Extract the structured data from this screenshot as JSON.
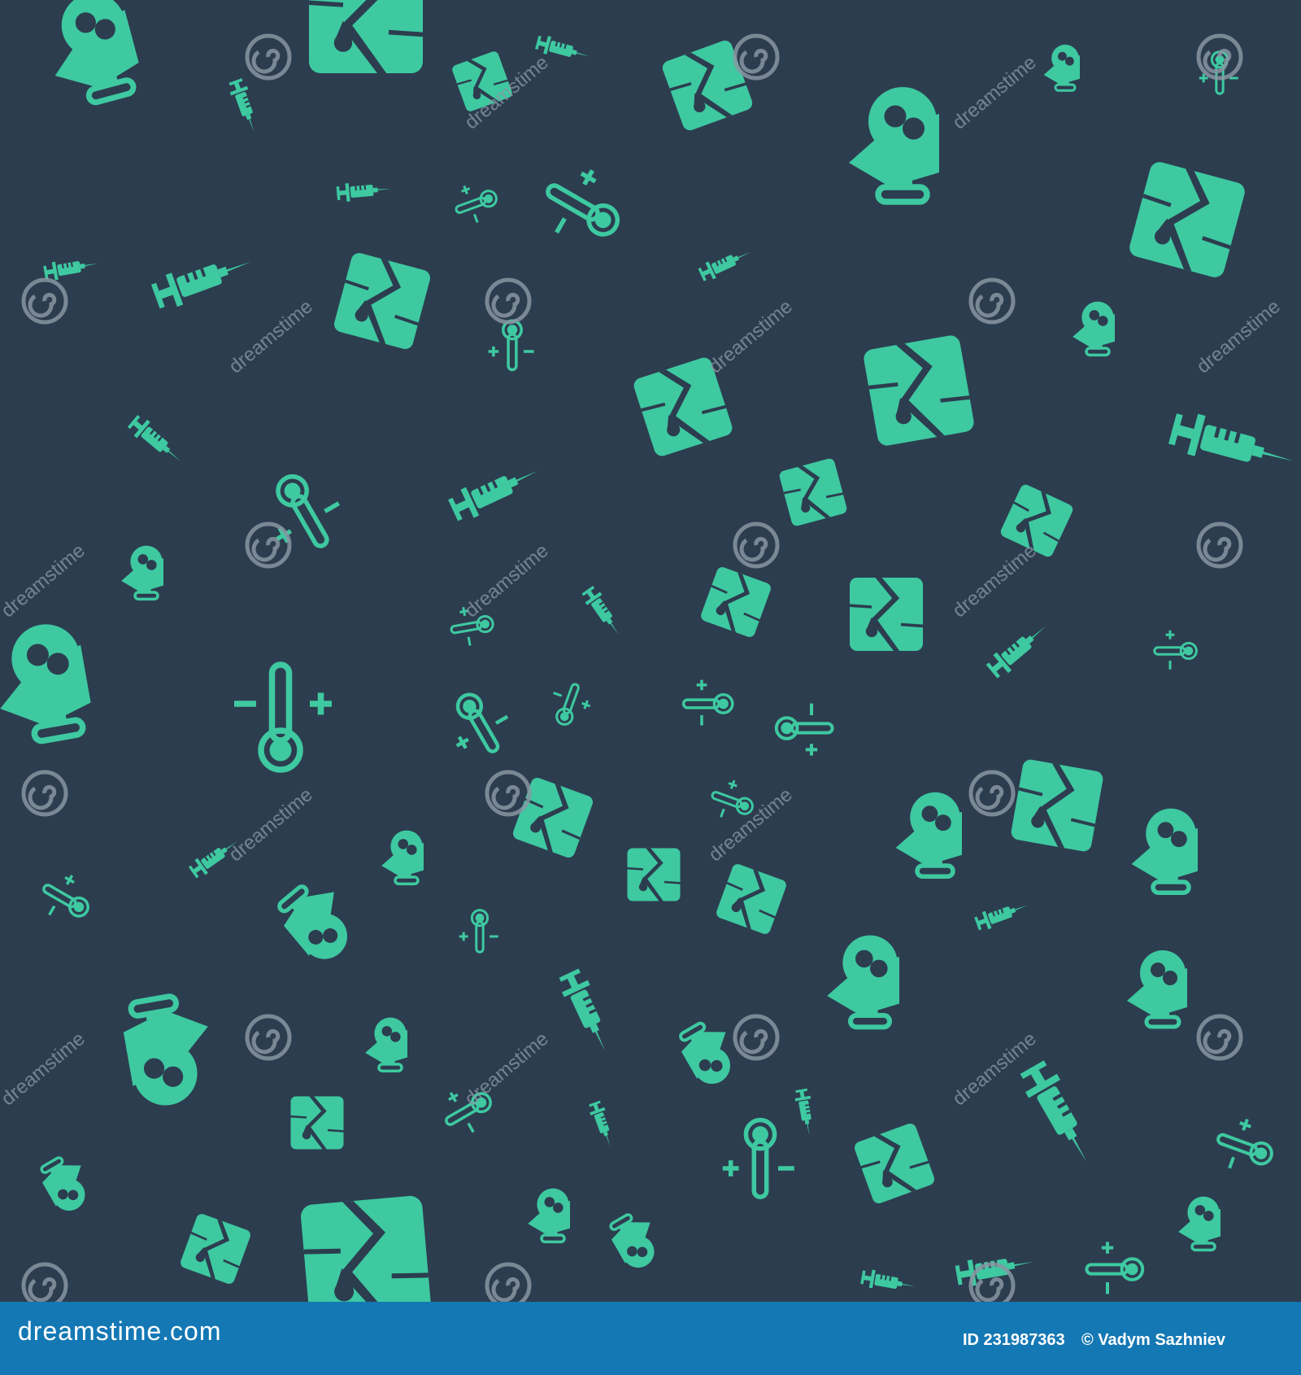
{
  "colors": {
    "background": "#2c3d4f",
    "icon": "#3ec9a1",
    "footer": "#1478b4",
    "watermark": "#8a96a3"
  },
  "pattern": {
    "icon_types": [
      "gas-mask-icon",
      "earthquake-crack-icon",
      "syringe-icon",
      "thermometer-icon"
    ],
    "watermark_text": "dreamstime"
  },
  "footer": {
    "logo": "dreamstime.com",
    "image_id": "ID 231987363",
    "author": "© Vadym Sazhniev"
  }
}
